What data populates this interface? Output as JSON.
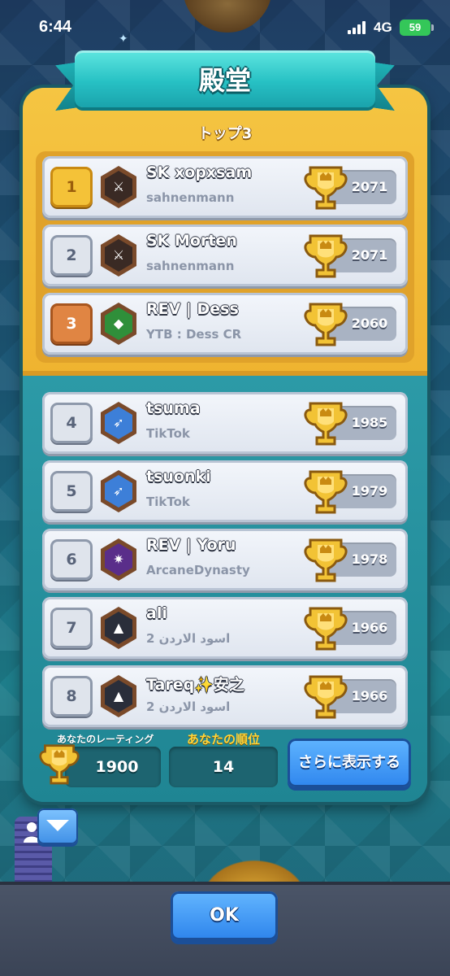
{
  "status_bar": {
    "time": "6:44",
    "network": "4G",
    "battery": "59"
  },
  "header": {
    "title": "殿堂"
  },
  "top3": {
    "label": "トップ3"
  },
  "players": [
    {
      "rank": "1",
      "rank_style": "gold",
      "name": "SK xopxsam",
      "clan": "sahnenmann",
      "trophies": "2071",
      "badge_icon": "bamboo-clan-badge-icon",
      "badge_glyph": "⚔",
      "badge_color": "#7a4a2a",
      "badge_inner": "#3a2a24"
    },
    {
      "rank": "2",
      "rank_style": "silver",
      "name": "SK Morten",
      "clan": "sahnenmann",
      "trophies": "2071",
      "badge_icon": "bamboo-clan-badge-icon",
      "badge_glyph": "⚔",
      "badge_color": "#7a4a2a",
      "badge_inner": "#3a2a24"
    },
    {
      "rank": "3",
      "rank_style": "bronze",
      "name": "REV | Dess",
      "clan": "YTB : Dess CR",
      "trophies": "2060",
      "badge_icon": "emerald-clan-badge-icon",
      "badge_glyph": "◆",
      "badge_color": "#7a4a2a",
      "badge_inner": "#2f8f3a"
    },
    {
      "rank": "4",
      "rank_style": "silver",
      "name": "tsuma",
      "clan": "TikTok",
      "trophies": "1985",
      "badge_icon": "arrow-clan-badge-icon",
      "badge_glyph": "➶",
      "badge_color": "#7a4a2a",
      "badge_inner": "#3d7fd8"
    },
    {
      "rank": "5",
      "rank_style": "silver",
      "name": "tsuonki",
      "clan": "TikTok",
      "trophies": "1979",
      "badge_icon": "arrow-clan-badge-icon",
      "badge_glyph": "➶",
      "badge_color": "#7a4a2a",
      "badge_inner": "#3d7fd8"
    },
    {
      "rank": "6",
      "rank_style": "silver",
      "name": "REV |  Yoru",
      "clan": "ArcaneDynasty",
      "trophies": "1978",
      "badge_icon": "starburst-clan-badge-icon",
      "badge_glyph": "✷",
      "badge_color": "#7a4a2a",
      "badge_inner": "#5a2e8a"
    },
    {
      "rank": "7",
      "rank_style": "silver",
      "name": "ali",
      "clan": "اسود الاردن 2",
      "trophies": "1966",
      "badge_icon": "mountain-clan-badge-icon",
      "badge_glyph": "▲",
      "badge_color": "#7a4a2a",
      "badge_inner": "#2a2e3a"
    },
    {
      "rank": "8",
      "rank_style": "silver",
      "name": "Tareq✨安之",
      "clan": "اسود الاردن 2",
      "trophies": "1966",
      "badge_icon": "mountain-clan-badge-icon",
      "badge_glyph": "▲",
      "badge_color": "#7a4a2a",
      "badge_inner": "#2a2e3a"
    }
  ],
  "footer": {
    "rating_label": "あなたのレーティング",
    "rating_value": "1900",
    "rank_label": "あなたの順位",
    "rank_value": "14",
    "more_label": "さらに表示する"
  },
  "bottom": {
    "ok_label": "OK"
  },
  "colors": {
    "accent_teal": "#27c1c4",
    "gold_panel": "#f5c542",
    "button_blue": "#2f86ee"
  }
}
